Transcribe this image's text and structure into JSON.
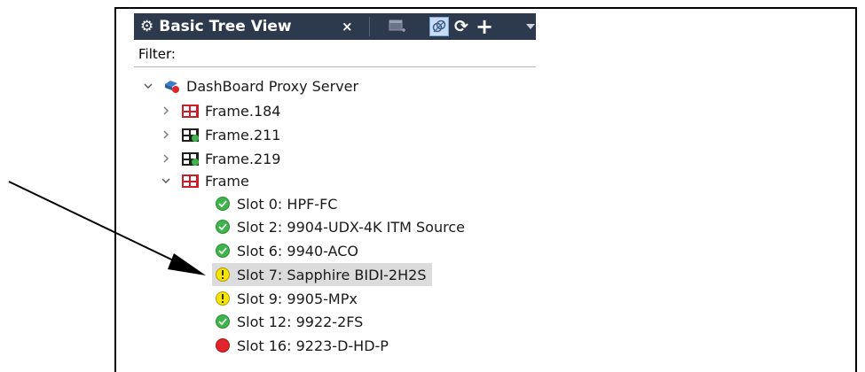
{
  "panel": {
    "title": "Basic Tree View",
    "close_glyph": "×",
    "toolbar": {
      "new_view_icon": "new-window-icon",
      "toggle_icon": "link-toggle-icon",
      "refresh_glyph": "⟳",
      "add_glyph": "+",
      "dropdown_icon": "chevron-down-icon"
    }
  },
  "filter": {
    "label": "Filter:",
    "value": "",
    "placeholder": ""
  },
  "tree": {
    "root": {
      "label": "DashBoard Proxy Server",
      "expanded": true,
      "icon": "proxy-server-icon"
    },
    "frames": [
      {
        "label": "Frame.184",
        "expanded": false,
        "status": "error"
      },
      {
        "label": "Frame.211",
        "expanded": false,
        "status": "ok"
      },
      {
        "label": "Frame.219",
        "expanded": false,
        "status": "ok"
      },
      {
        "label": "Frame",
        "expanded": true,
        "status": "error"
      }
    ],
    "slots": [
      {
        "label": "Slot 0: HPF-FC",
        "status": "ok"
      },
      {
        "label": "Slot 2: 9904-UDX-4K ITM Source",
        "status": "ok"
      },
      {
        "label": "Slot 6: 9940-ACO",
        "status": "ok"
      },
      {
        "label": "Slot 7: Sapphire BIDI-2H2S",
        "status": "warning",
        "selected": true
      },
      {
        "label": "Slot 9: 9905-MPx",
        "status": "warning"
      },
      {
        "label": "Slot 12: 9922-2FS",
        "status": "ok"
      },
      {
        "label": "Slot 16: 9223-D-HD-P",
        "status": "error"
      }
    ]
  },
  "colors": {
    "titlebar_bg": "#2d3a4e",
    "status_ok": "#3eb54a",
    "status_warning": "#f4e400",
    "status_error": "#e0242a",
    "selection_bg": "#dcdcdc"
  }
}
